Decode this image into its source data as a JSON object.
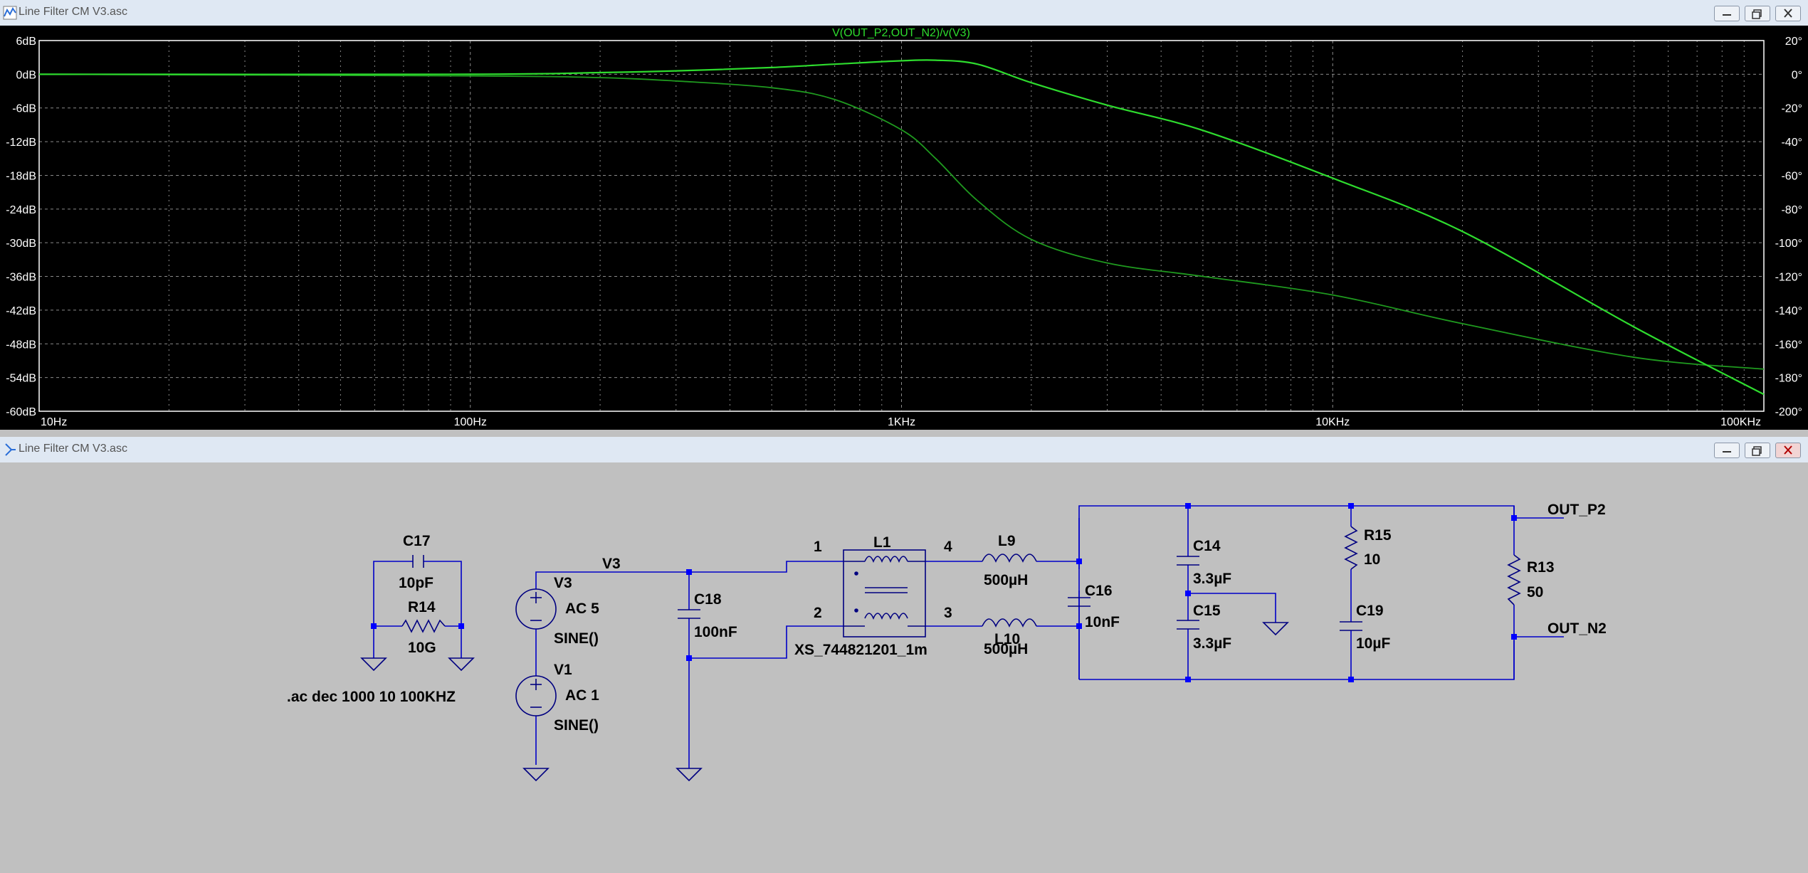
{
  "plot_window": {
    "title": "Line Filter CM V3.asc",
    "trace_label": "V(OUT_P2,OUT_N2)/v(V3)"
  },
  "schematic_window": {
    "title": "Line Filter CM V3.asc"
  },
  "chart_data": {
    "type": "line",
    "title": "V(OUT_P2,OUT_N2)/v(V3)",
    "x_scale": "log",
    "xlim": [
      10,
      100000
    ],
    "x_ticks": [
      "10Hz",
      "100Hz",
      "1KHz",
      "10KHz",
      "100KHz"
    ],
    "y_left_ticks": [
      "6dB",
      "0dB",
      "-6dB",
      "-12dB",
      "-18dB",
      "-24dB",
      "-30dB",
      "-36dB",
      "-42dB",
      "-48dB",
      "-54dB",
      "-60dB"
    ],
    "ylim_left": [
      -60,
      6
    ],
    "y_right_ticks": [
      "20°",
      "0°",
      "-20°",
      "-40°",
      "-60°",
      "-80°",
      "-100°",
      "-120°",
      "-140°",
      "-160°",
      "-180°",
      "-200°"
    ],
    "ylim_right": [
      -200,
      20
    ],
    "grid": true,
    "colors": {
      "magnitude": "#2edc2e",
      "phase": "#1f9a1f",
      "label": "#2edc2e",
      "background": "#000000",
      "axis_text": "#ffffff"
    },
    "series": [
      {
        "axis": "left",
        "x": [
          10,
          100,
          200,
          300,
          500,
          700,
          1000,
          1200,
          1500,
          2000,
          3000,
          5000,
          10000,
          20000,
          50000,
          100000
        ],
        "values": [
          0,
          0,
          0.3,
          0.6,
          1.2,
          1.8,
          2.4,
          2.5,
          1.8,
          -1.5,
          -5.5,
          -10,
          -18.5,
          -28,
          -45,
          -57
        ]
      },
      {
        "axis": "right",
        "x": [
          10,
          100,
          200,
          300,
          500,
          700,
          1000,
          1200,
          1500,
          2000,
          3000,
          5000,
          10000,
          20000,
          50000,
          100000
        ],
        "values": [
          0,
          -1,
          -2,
          -4,
          -8,
          -15,
          -33,
          -50,
          -75,
          -98,
          -112,
          -120,
          -131,
          -148,
          -168,
          -175
        ]
      }
    ]
  },
  "schematic": {
    "labels": {
      "C17": "C17",
      "C17_val": "10pF",
      "R14": "R14",
      "R14_val": "10G",
      "directive": ".ac dec 1000 10 100KHZ",
      "V3": "V3",
      "V3_ac": "AC 5",
      "V3_sine": "SINE()",
      "V1": "V1",
      "V1_ac": "AC 1",
      "V1_sine": "SINE()",
      "net_V3": "V3",
      "C18": "C18",
      "C18_val": "100nF",
      "pin1": "1",
      "pin2": "2",
      "pin3": "3",
      "pin4": "4",
      "L1": "L1",
      "L1_model": "XS_744821201_1m",
      "L9": "L9",
      "L9_val": "500µH",
      "L10": "L10",
      "L10_val": "500µH",
      "C16": "C16",
      "C16_val": "10nF",
      "C14": "C14",
      "C14_val": "3.3µF",
      "C15": "C15",
      "C15_val": "3.3µF",
      "R15": "R15",
      "R15_val": "10",
      "C19": "C19",
      "C19_val": "10µF",
      "R13": "R13",
      "R13_val": "50",
      "out_p2": "OUT_P2",
      "out_n2": "OUT_N2"
    },
    "colors": {
      "wire": "#0000c8",
      "component": "#000080",
      "junction": "#0000ff",
      "text": "#000000"
    }
  }
}
